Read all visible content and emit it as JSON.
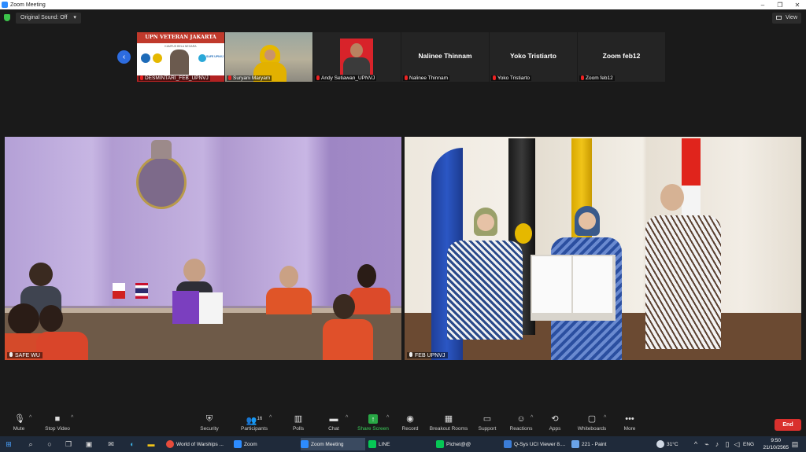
{
  "window": {
    "title": "Zoom Meeting",
    "minimize": "–",
    "maximize": "❐",
    "close": "✕"
  },
  "topbar": {
    "sound_label": "Original Sound: Off",
    "sound_caret": "▾",
    "view_label": "View"
  },
  "gallery": {
    "prev_arrow": "‹",
    "tiles": [
      {
        "label": "DESMINTARI_FEB_UPNVJ",
        "banner": "UPN VETERAN JAKARTA",
        "banner_sub": "KAMPUS BELA NEGARA",
        "side_text": "SAFE UPNVJ"
      },
      {
        "label": "Suryani Maryam"
      },
      {
        "label": "Andy Setiawan_UPNVJ"
      },
      {
        "name": "Nalinee Thinnam",
        "label": "Nalinee Thinnam"
      },
      {
        "name": "Yoko Tristiarto",
        "label": "Yoko Tristiarto"
      },
      {
        "name": "Zoom feb12",
        "label": "Zoom feb12"
      }
    ]
  },
  "videos": {
    "left_label": "SAFE WU",
    "right_label": "FEB UPNVJ"
  },
  "toolbar": {
    "mute": "Mute",
    "stop_video": "Stop Video",
    "security": "Security",
    "participants": "Participants",
    "participants_count": "16",
    "polls": "Polls",
    "chat": "Chat",
    "share_screen": "Share Screen",
    "record": "Record",
    "breakout_rooms": "Breakout Rooms",
    "support": "Support",
    "reactions": "Reactions",
    "apps": "Apps",
    "whiteboards": "Whiteboards",
    "more": "More",
    "end": "End"
  },
  "taskbar": {
    "apps": [
      {
        "label": "World of Warships ...",
        "color": "#e74c3c"
      },
      {
        "label": "Zoom",
        "color": "#2d8cff"
      },
      {
        "label": "Zoom Meeting",
        "color": "#2d8cff"
      },
      {
        "label": "LINE",
        "color": "#06c755"
      },
      {
        "label": "Pichet@@",
        "color": "#06c755"
      },
      {
        "label": "Q-Sys UCI Viewer 8....",
        "color": "#3b7dd8"
      },
      {
        "label": "221 - Paint",
        "color": "#6aa3e8"
      }
    ],
    "weather": "31°C",
    "lang": "ENG",
    "time": "9:50",
    "date": "21/10/2565"
  },
  "colors": {
    "accent_blue": "#2d8cff",
    "end_red": "#d9302d",
    "share_green": "#28a745"
  }
}
